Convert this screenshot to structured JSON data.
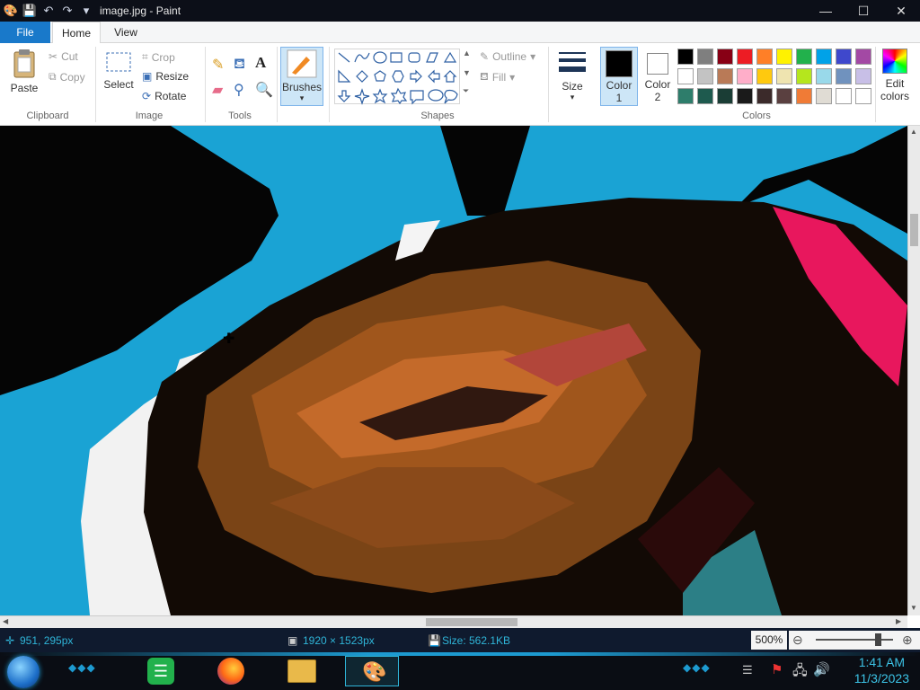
{
  "window": {
    "title": "image.jpg - Paint",
    "controls": [
      "—",
      "☐",
      "✕"
    ]
  },
  "tabs": [
    "File",
    "Home",
    "View"
  ],
  "ribbon": {
    "clipboard": {
      "paste": "Paste",
      "cut": "Cut",
      "copy": "Copy",
      "label": "Clipboard"
    },
    "image": {
      "select": "Select",
      "crop": "Crop",
      "resize": "Resize",
      "rotate": "Rotate",
      "label": "Image"
    },
    "tools": {
      "label": "Tools"
    },
    "brushes": {
      "label": "Brushes"
    },
    "shapes": {
      "outline": "Outline",
      "fill": "Fill",
      "label": "Shapes"
    },
    "size": {
      "label": "Size"
    },
    "color1": {
      "label1": "Color",
      "label2": "1",
      "value": "#000000"
    },
    "color2": {
      "label1": "Color",
      "label2": "2",
      "value": "#ffffff"
    },
    "colors": {
      "label": "Colors",
      "palette": [
        "#000000",
        "#7f7f7f",
        "#880015",
        "#ed1c24",
        "#ff7f27",
        "#fff200",
        "#22b14c",
        "#00a2e8",
        "#3f48cc",
        "#a349a4",
        "#ffffff",
        "#c3c3c3",
        "#b97a57",
        "#ffaec9",
        "#ffc90e",
        "#efe4b0",
        "#b5e61d",
        "#99d9ea",
        "#7092be",
        "#c8bfe7",
        "#2e7d6b",
        "#1e5a4e",
        "#1a3d35",
        "#1a1a1a",
        "#3b2a2a",
        "#5a4040",
        "#f07b36",
        "#e0dcd4",
        "#ffffff",
        "#ffffff"
      ]
    },
    "edit_colors": {
      "line1": "Edit",
      "line2": "colors"
    }
  },
  "status": {
    "cursor": "951, 295px",
    "dimensions": "1920 × 1523px",
    "size": "Size: 562.1KB",
    "zoom": "500%",
    "zoom_level": 0.8
  },
  "taskbar": {
    "time": "1:41 AM",
    "date": "11/3/2023",
    "apps": [
      "start-orb",
      "notes-app",
      "firefox",
      "file-explorer",
      "paint"
    ]
  }
}
